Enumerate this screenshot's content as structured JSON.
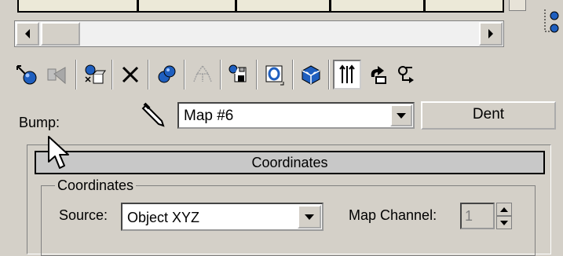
{
  "toolbar": {
    "icons": [
      "get-material-icon",
      "put-to-scene-icon",
      "assign-material-icon",
      "delete-icon",
      "make-unique-icon",
      "pick-material-icon",
      "put-to-library-icon",
      "material-id-channel-icon",
      "show-map-icon",
      "show-end-result-icon",
      "go-to-parent-icon",
      "go-forward-icon"
    ]
  },
  "bump": {
    "label": "Bump:",
    "map_value": "Map #6",
    "map_type_button": "Dent"
  },
  "rollout": {
    "title": "Coordinates",
    "group_title": "Coordinates",
    "source_label": "Source:",
    "source_value": "Object XYZ",
    "map_channel_label": "Map Channel:",
    "map_channel_value": "1"
  },
  "colors": {
    "panel_bg": "#d4d0c8",
    "field_bg": "#ffffff",
    "icon_blue": "#1f5fbf"
  }
}
